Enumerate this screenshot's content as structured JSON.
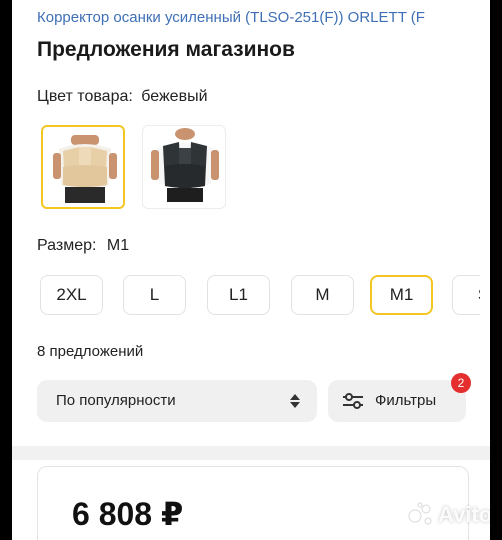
{
  "product": {
    "title": "Корректор осанки усиленный (TLSO-251(F)) ORLETT (F"
  },
  "section": {
    "title": "Предложения магазинов"
  },
  "color": {
    "label": "Цвет товара:",
    "value": "бежевый"
  },
  "colors": [
    {
      "name": "бежевый",
      "color": "#e9d3b0",
      "selected": true
    },
    {
      "name": "черный",
      "color": "#2f3437",
      "selected": false
    }
  ],
  "size": {
    "label": "Размер:",
    "value": "M1",
    "options": [
      "2XL",
      "L",
      "L1",
      "M",
      "M1",
      "S"
    ]
  },
  "offers": {
    "count_text": "8 предложений"
  },
  "sort": {
    "label": "По популярности"
  },
  "filters": {
    "label": "Фильтры",
    "badge": "2"
  },
  "price": {
    "value": "6 808 ₽"
  },
  "watermark": {
    "text": "Avito"
  },
  "accent": "#f3c623",
  "link_color": "#3f6fb6",
  "badge_color": "#e52e2e"
}
